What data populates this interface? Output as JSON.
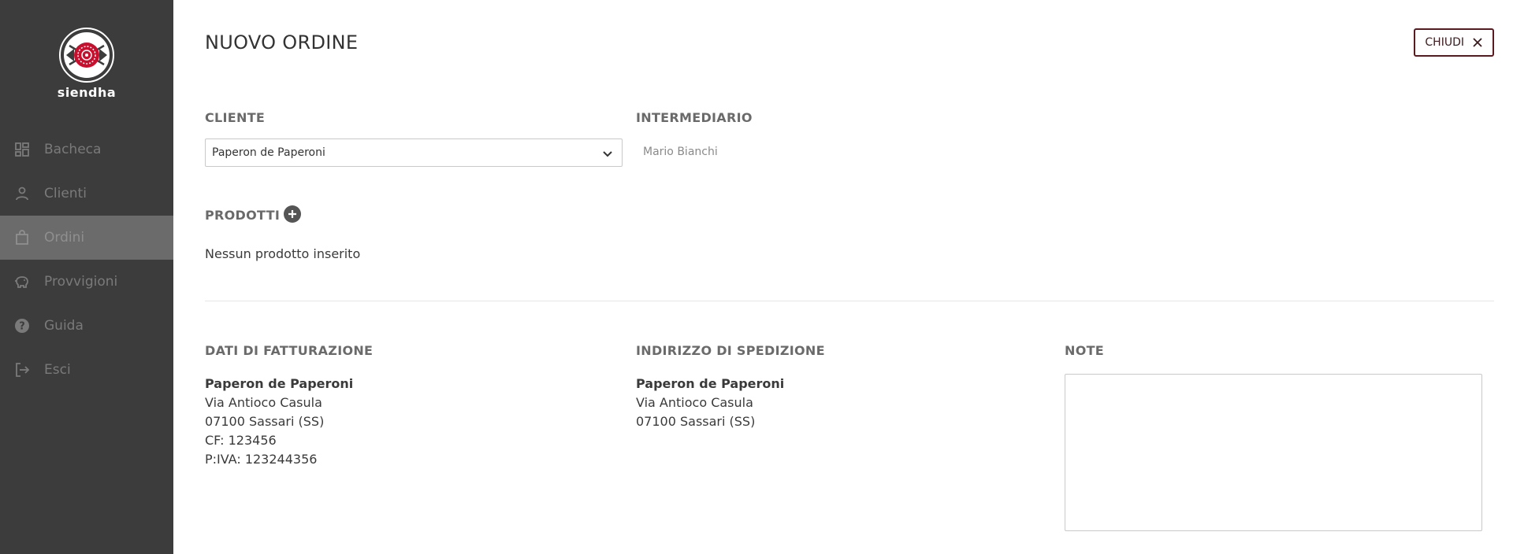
{
  "app": {
    "logo_text": "siendha"
  },
  "sidebar": {
    "items": [
      {
        "label": "Bacheca",
        "icon": "dashboard-icon"
      },
      {
        "label": "Clienti",
        "icon": "person-icon"
      },
      {
        "label": "Ordini",
        "icon": "shopping-bag-icon",
        "active": true
      },
      {
        "label": "Provvigioni",
        "icon": "piggy-bank-icon"
      },
      {
        "label": "Guida",
        "icon": "help-icon"
      },
      {
        "label": "Esci",
        "icon": "logout-icon"
      }
    ]
  },
  "header": {
    "title": "NUOVO ORDINE",
    "close_label": "CHIUDI"
  },
  "cliente": {
    "label": "CLIENTE",
    "selected": "Paperon de Paperoni"
  },
  "intermediario": {
    "label": "INTERMEDIARIO",
    "value": "Mario Bianchi"
  },
  "prodotti": {
    "label": "PRODOTTI",
    "empty_text": "Nessun prodotto inserito"
  },
  "fatturazione": {
    "label": "DATI DI FATTURAZIONE",
    "name": "Paperon de Paperoni",
    "street": "Via Antioco Casula",
    "city": "07100 Sassari (SS)",
    "cf": "CF: 123456",
    "piva": "P:IVA: 123244356"
  },
  "spedizione": {
    "label": "INDIRIZZO DI SPEDIZIONE",
    "name": "Paperon de Paperoni",
    "street": "Via Antioco Casula",
    "city": "07100 Sassari (SS)"
  },
  "note": {
    "label": "NOTE",
    "value": ""
  },
  "colors": {
    "sidebar_bg": "#3c3c3c",
    "sidebar_active": "#6b6b6b",
    "accent": "#5a1a1f",
    "logo_red": "#c8102e"
  }
}
